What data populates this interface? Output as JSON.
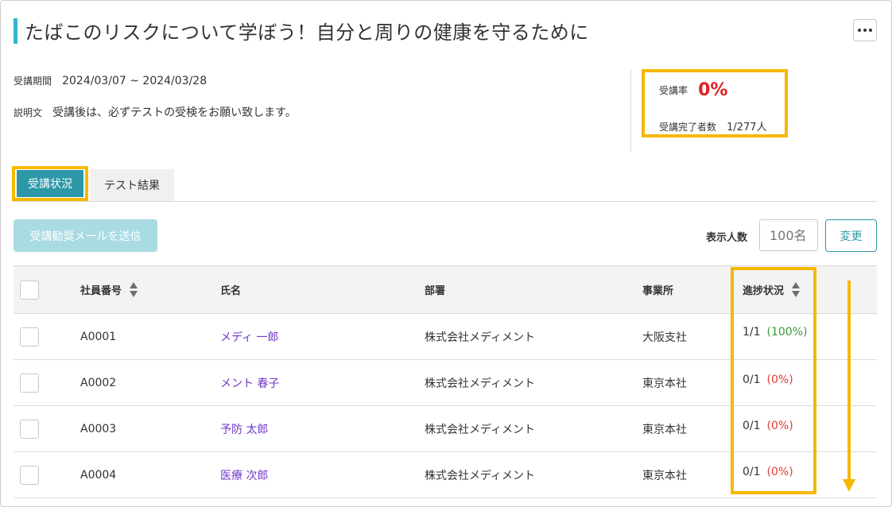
{
  "page": {
    "title": "たばこのリスクについて学ぼう！自分と周りの健康を守るために"
  },
  "info": {
    "period_label": "受講期間",
    "period_value": "2024/03/07 ~ 2024/03/28",
    "description_label": "説明文",
    "description_value": "受講後は、必ずテストの受検をお願い致します。"
  },
  "stats": {
    "rate_label": "受講率",
    "rate_value": "0%",
    "completed_label": "受講完了者数",
    "completed_value": "1/277人"
  },
  "tabs": [
    {
      "label": "受講状況",
      "active": true
    },
    {
      "label": "テスト結果",
      "active": false
    }
  ],
  "toolbar": {
    "send_label": "受講勧奨メールを送信",
    "count_label": "表示人数",
    "count_placeholder": "100名",
    "change_label": "変更"
  },
  "table": {
    "headers": {
      "employee_id": "社員番号",
      "name": "氏名",
      "department": "部署",
      "office": "事業所",
      "progress": "進捗状況"
    },
    "rows": [
      {
        "employee_id": "A0001",
        "name": "メディ 一郎",
        "department": "株式会社メディメント",
        "office": "大阪支社",
        "progress": "1/1",
        "percent": "(100%)"
      },
      {
        "employee_id": "A0002",
        "name": "メント 春子",
        "department": "株式会社メディメント",
        "office": "東京本社",
        "progress": "0/1",
        "percent": "(0%)"
      },
      {
        "employee_id": "A0003",
        "name": "予防 太郎",
        "department": "株式会社メディメント",
        "office": "東京本社",
        "progress": "0/1",
        "percent": "(0%)"
      },
      {
        "employee_id": "A0004",
        "name": "医療 次郎",
        "department": "株式会社メディメント",
        "office": "東京本社",
        "progress": "0/1",
        "percent": "(0%)"
      }
    ]
  },
  "colors": {
    "accent_teal": "#2b97a7",
    "title_bar": "#35b6c8",
    "highlight": "#f5b800",
    "rate_red": "#e02020",
    "link_purple": "#7038c8",
    "progress_green": "#3a9a3a",
    "progress_red": "#e03a3a"
  },
  "icons": [
    "more-options-icon",
    "sort-icon",
    "scroll-down-arrow-icon"
  ]
}
